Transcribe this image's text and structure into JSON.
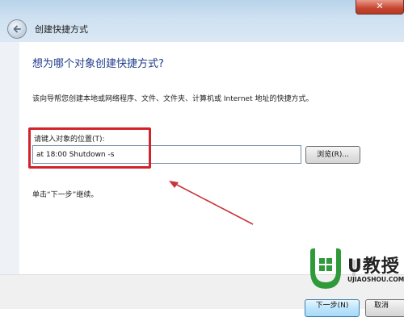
{
  "window": {
    "title": "创建快捷方式",
    "close_symbol": "✕"
  },
  "page": {
    "heading": "想为哪个对象创建快捷方式?",
    "description": "该向导帮您创建本地或网络程序、文件、文件夹、计算机或 Internet 地址的快捷方式。",
    "location_label": "请键入对象的位置(T):",
    "location_value": "at 18:00 Shutdown -s",
    "browse_label": "浏览(R)...",
    "continue_text": "单击“下一步”继续。"
  },
  "footer": {
    "next_label": "下一步(N)",
    "cancel_label": "取消"
  },
  "watermark": {
    "brand": "U教授",
    "url": "UJIAOSHOU.COM"
  },
  "annotation": {
    "highlight_color": "#d2232a",
    "arrow_color": "#c8343a"
  },
  "icons": {
    "back": "back-arrow-icon",
    "close": "close-icon",
    "logo": "windows-logo-icon"
  }
}
